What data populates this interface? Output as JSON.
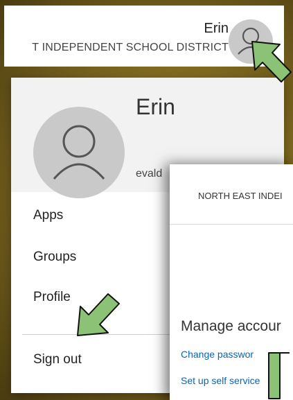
{
  "header": {
    "user_name": "Erin",
    "org_name": "T INDEPENDENT SCHOOL DISTRICT"
  },
  "dropdown": {
    "name": "Erin",
    "email": "evald",
    "menu": [
      "Apps",
      "Groups",
      "Profile",
      "Sign out"
    ]
  },
  "account_window": {
    "org_name": "NORTH EAST INDEI",
    "section_title": "Manage accour",
    "links": [
      "Change passwor",
      "Set up self service"
    ]
  },
  "icons": {
    "avatar": "person-icon",
    "pointer": "arrow-pointer-icon"
  },
  "colors": {
    "background": "#a98f2b",
    "avatar_bg": "#c9c9c9",
    "link": "#0066c0",
    "arrow_fill": "#8cc276"
  }
}
